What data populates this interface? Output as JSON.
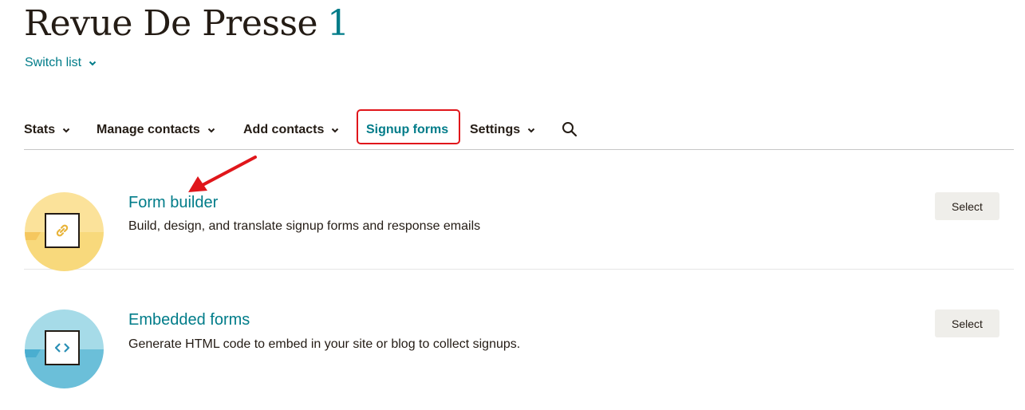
{
  "header": {
    "title": "Revue De Presse",
    "count": "1",
    "switch_list": "Switch list"
  },
  "nav": {
    "items": [
      {
        "label": "Stats",
        "dropdown": true
      },
      {
        "label": "Manage contacts",
        "dropdown": true
      },
      {
        "label": "Add contacts",
        "dropdown": true
      },
      {
        "label": "Signup forms",
        "dropdown": false,
        "active": true
      },
      {
        "label": "Settings",
        "dropdown": true
      }
    ],
    "search_icon": "search-icon"
  },
  "options": [
    {
      "title": "Form builder",
      "description": "Build, design, and translate signup forms and response emails",
      "button": "Select",
      "icon": "link-icon",
      "circle_color": "#fbe29a"
    },
    {
      "title": "Embedded forms",
      "description": "Generate HTML code to embed in your site or blog to collect signups.",
      "button": "Select",
      "icon": "code-icon",
      "circle_color": "#a6dbe8"
    }
  ],
  "colors": {
    "accent": "#007c89",
    "highlight": "#e0161b",
    "text": "#241c15"
  }
}
